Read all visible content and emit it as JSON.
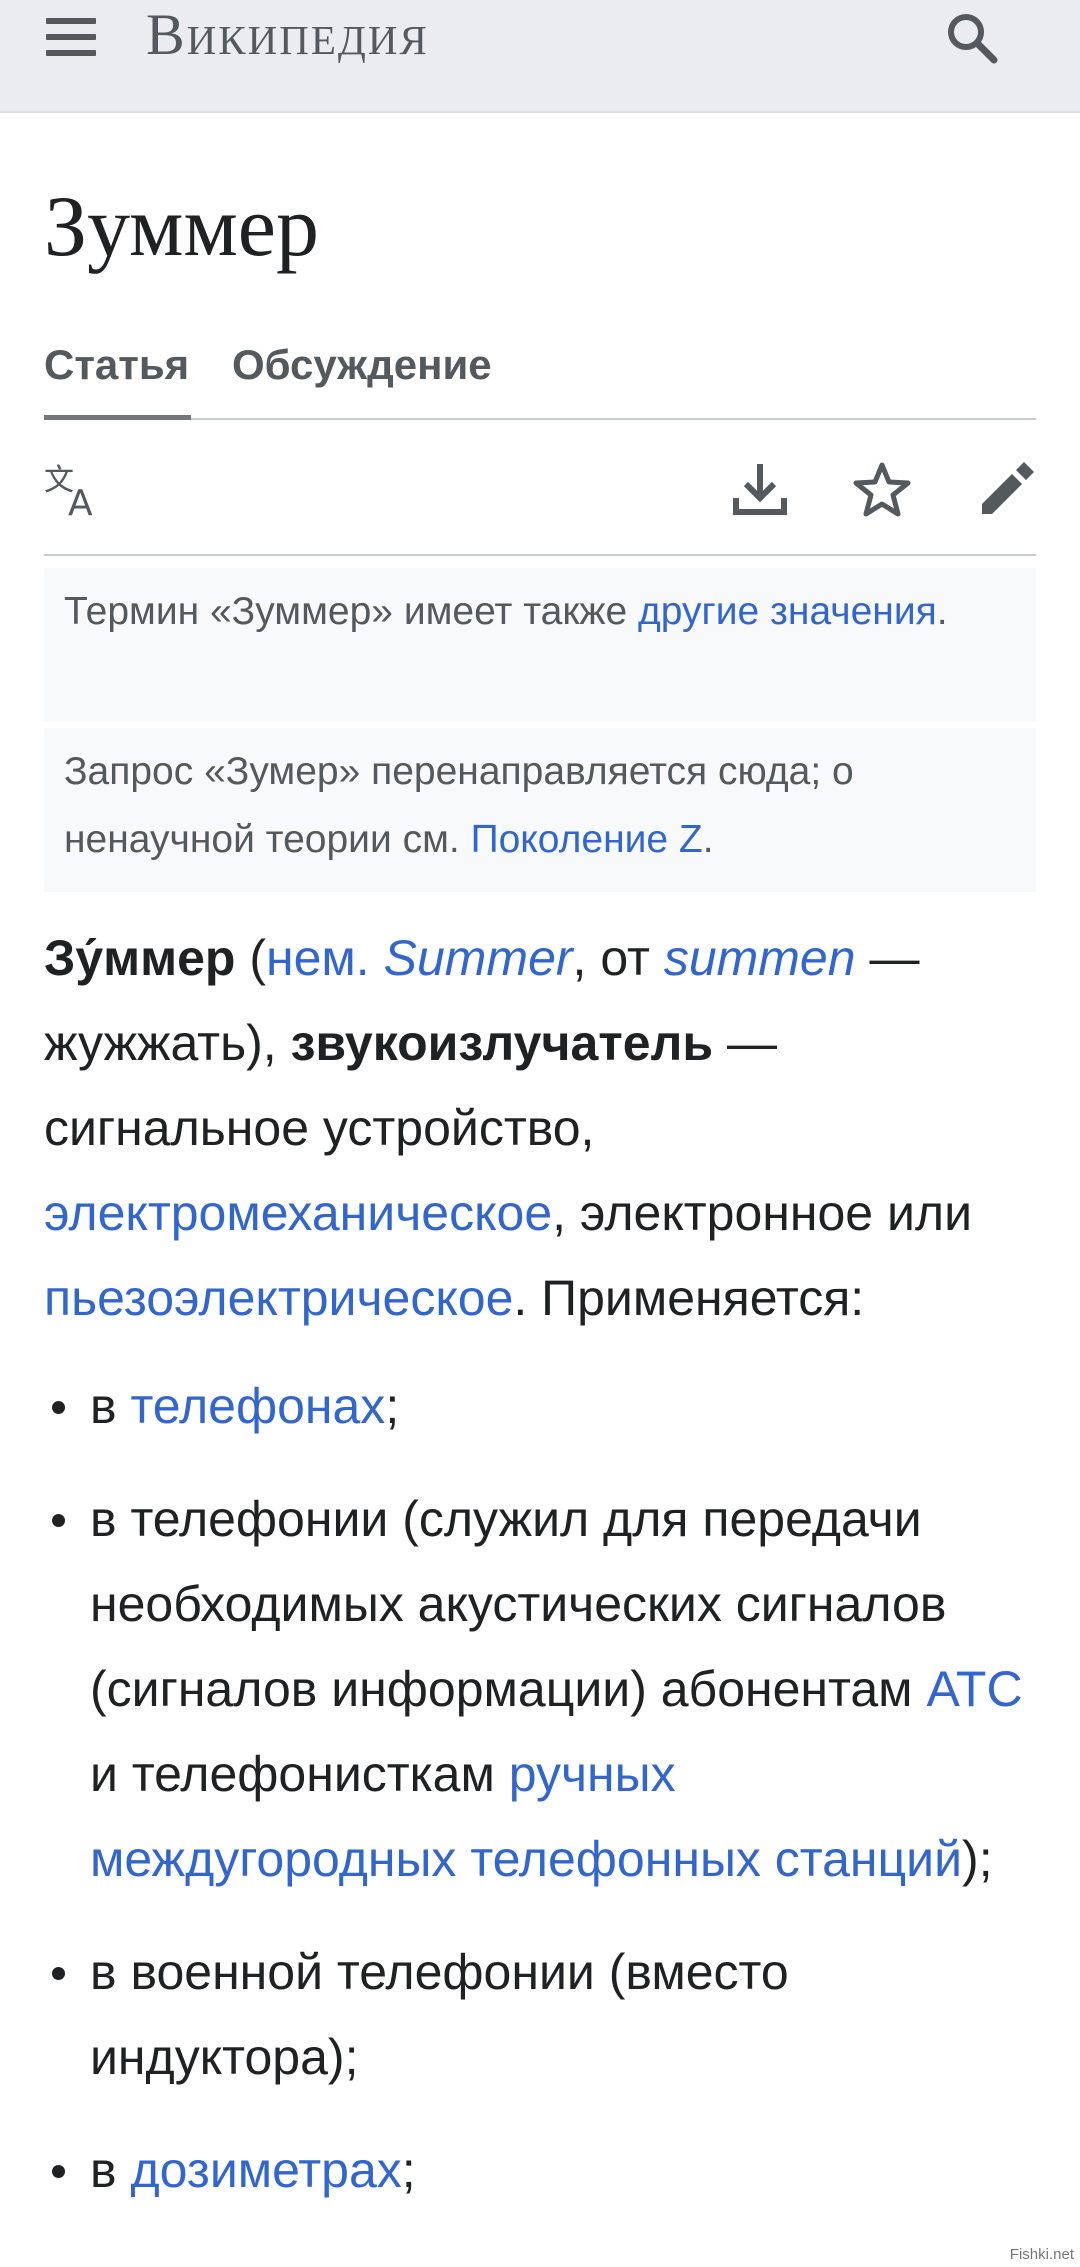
{
  "header": {
    "wordmark": "Википедия",
    "menu_icon": "hamburger-menu-icon",
    "search_icon": "search-icon"
  },
  "article": {
    "title": "Зуммер"
  },
  "tabs": [
    {
      "label": "Статья",
      "active": true
    },
    {
      "label": "Обсуждение",
      "active": false
    }
  ],
  "toolbar": {
    "icons": [
      "language-icon",
      "download-icon",
      "star-icon",
      "edit-pencil-icon"
    ]
  },
  "hatnotes": {
    "first": {
      "text": "Термин «Зуммер» имеет также ",
      "link": "другие значения",
      "end": "."
    },
    "second": {
      "text": "Запрос «Зумер» перенаправляется сюда; о ненаучной теории см. ",
      "link": "Поколение Z",
      "end": "."
    }
  },
  "lead": {
    "term": "Зу́ммер",
    "open_paren": " (",
    "lang_link": "нем.",
    "space": " ",
    "german_word": "Summer",
    "from_text": ", от ",
    "summen_word": "summen",
    "dash_text": " — жужжать), ",
    "term2": "звукоизлучатель",
    "def_text": " — сигнальное устройство, ",
    "link_electromech": "электромеханическое",
    "mid_text": ", электронное или ",
    "link_piezo": "пьезоэлектрическое",
    "end_text": ". Применяется:"
  },
  "uses": {
    "item1": {
      "pre": "в ",
      "link": "телефонах",
      "post": ";"
    },
    "item2": {
      "pre": "в телефонии (служил для передачи необходимых акустических сигналов (сигналов информации) абонентам ",
      "link1": "АТС",
      "mid": " и телефонисткам ",
      "link2": "ручных междугородных телефонных станций",
      "post": ");"
    },
    "item3": {
      "text": "в военной телефонии (вместо индуктора);"
    },
    "item4": {
      "pre": "в ",
      "link": "дозиметрах",
      "post": ";"
    }
  },
  "watermark": "Fishki.net",
  "colors": {
    "link": "#3366cc",
    "header_bg": "#eaecf0",
    "hatnote_bg": "#f8f9fa",
    "icon": "#54595d"
  }
}
